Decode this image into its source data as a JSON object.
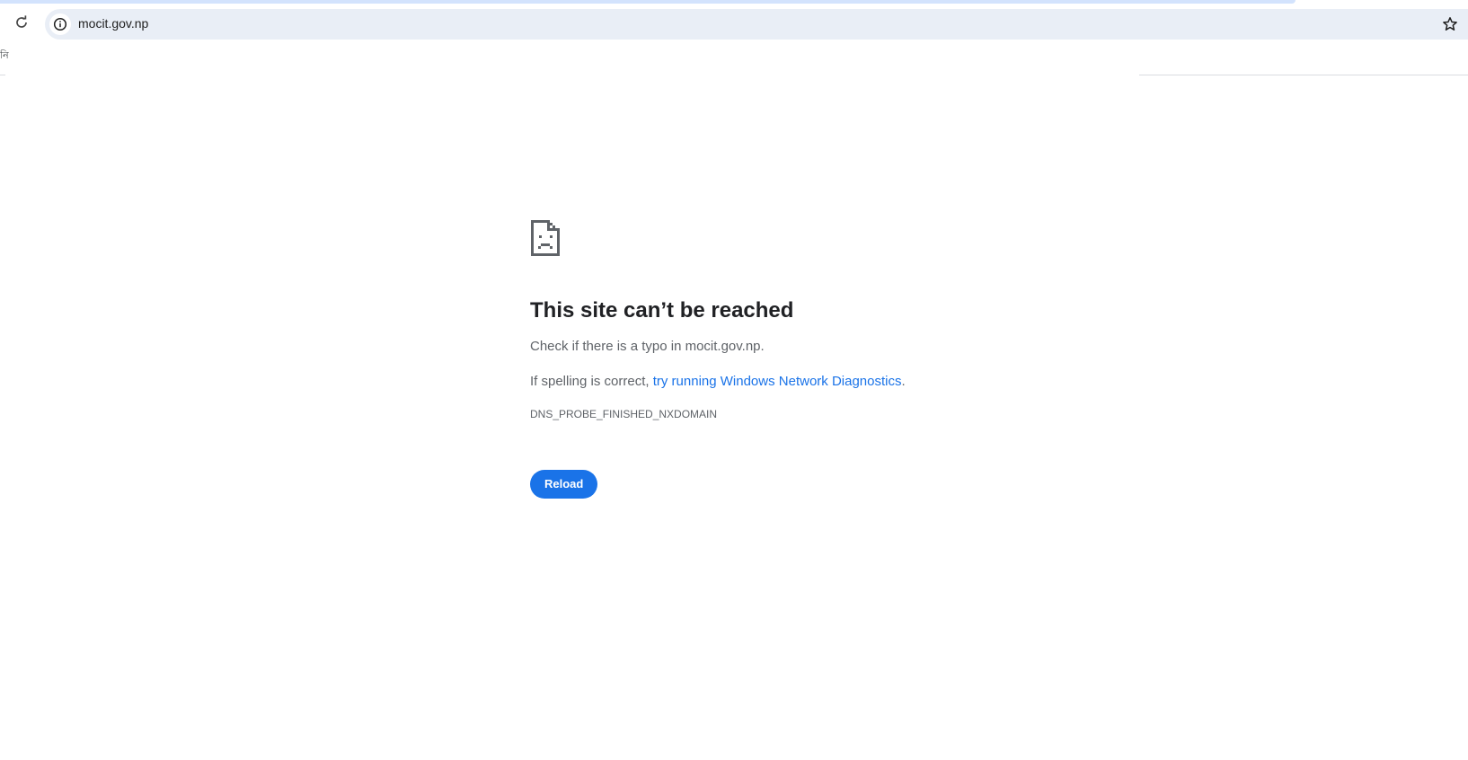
{
  "browser": {
    "url": "mocit.gov.np",
    "bookmark_fragment": "নি"
  },
  "error": {
    "title": "This site can’t be reached",
    "suggestion_typo": "Check if there is a typo in mocit.gov.np.",
    "suggestion_prefix": "If spelling is correct, ",
    "suggestion_link": "try running Windows Network Diagnostics",
    "suggestion_suffix": ".",
    "code": "DNS_PROBE_FINISHED_NXDOMAIN",
    "reload_label": "Reload"
  },
  "icons": {
    "reload": "reload-icon",
    "site_info": "info-icon",
    "bookmark": "star-icon",
    "error": "sad-document-icon"
  },
  "colors": {
    "accent": "#1a73e8",
    "omnibox": "#e9eef6",
    "tab_edge": "#d3e3fd",
    "title": "#202124",
    "body_text": "#5f6368"
  }
}
